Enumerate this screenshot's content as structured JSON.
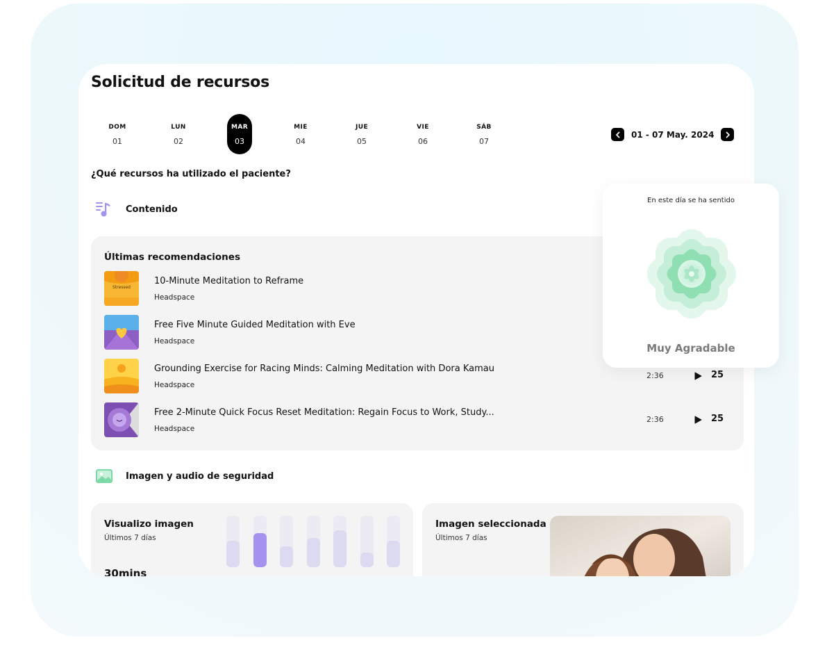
{
  "title": "Solicitud de recursos",
  "days": [
    {
      "name": "DOM",
      "num": "01"
    },
    {
      "name": "LUN",
      "num": "02"
    },
    {
      "name": "MAR",
      "num": "03"
    },
    {
      "name": "MIE",
      "num": "04"
    },
    {
      "name": "JUE",
      "num": "05"
    },
    {
      "name": "VIE",
      "num": "06"
    },
    {
      "name": "SÁB",
      "num": "07"
    }
  ],
  "active_day": "MAR",
  "date_range": "01 - 07 May. 2024",
  "question": "¿Qué recursos ha utilizado el paciente?",
  "content_section": {
    "label": "Contenido",
    "panel_title": "Últimas recomendaciones",
    "items": [
      {
        "title": "10-Minute Meditation to Reframe",
        "source": "Headspace",
        "duration": "",
        "plays": "",
        "thumb_text": "Stressed"
      },
      {
        "title": "Free Five Minute Guided Meditation with Eve",
        "source": "Headspace",
        "duration": "",
        "plays": ""
      },
      {
        "title": "Grounding Exercise for Racing Minds: Calming Meditation with Dora Kamau",
        "source": "Headspace",
        "duration": "2:36",
        "plays": "25"
      },
      {
        "title": "Free 2-Minute Quick Focus Reset Meditation: Regain Focus to Work, Study...",
        "source": "Headspace",
        "duration": "2:36",
        "plays": "25"
      }
    ]
  },
  "safety_section": {
    "label": "Imagen y audio de seguridad",
    "visual": {
      "title": "Visualizo imagen",
      "subtitle": "Últimos 7 días",
      "value": "30mins",
      "bar_levels": [
        0.52,
        0.66,
        0.4,
        0.57,
        0.71,
        0.28,
        0.52
      ],
      "active_bar": 1
    },
    "selected": {
      "title": "Imagen seleccionada",
      "subtitle": "Últimos 7 días"
    }
  },
  "mood": {
    "subtitle": "En este día se ha sentido",
    "label": "Muy Agradable"
  },
  "colors": {
    "accent_purple": "#a592ee",
    "panel_bg": "#f4f4f4",
    "mood_green": "#7ed9a8"
  }
}
